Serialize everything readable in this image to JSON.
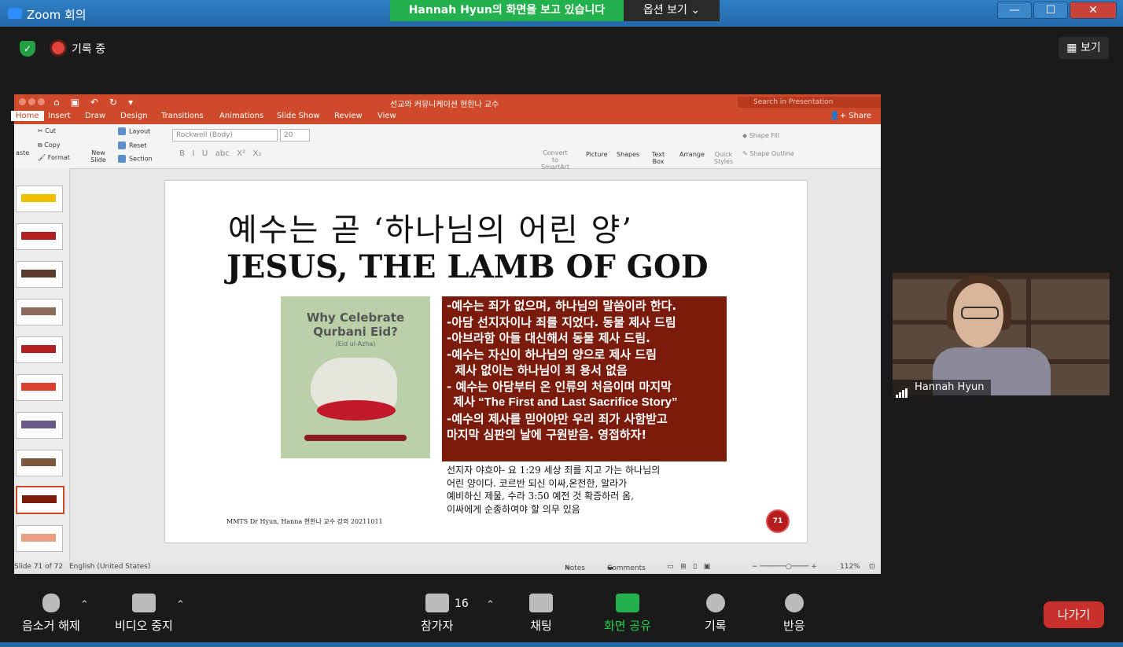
{
  "window": {
    "title": "Zoom 회의",
    "minimize": "—",
    "maximize": "☐",
    "close": "✕"
  },
  "share_banner": {
    "text": "Hannah Hyun의 화면을 보고 있습니다",
    "options": "옵션 보기 ⌄"
  },
  "meeting": {
    "recording": "기록 중",
    "view": "보기"
  },
  "ppt": {
    "doc_title": "선교와 커뮤니케이션 현한나 교수",
    "search_placeholder": "Search in Presentation",
    "share": "Share",
    "tabs": [
      "Home",
      "Insert",
      "Draw",
      "Design",
      "Transitions",
      "Animations",
      "Slide Show",
      "Review",
      "View"
    ],
    "ribbon": {
      "paste": "aste",
      "cut": "Cut",
      "copy": "Copy",
      "format": "Format",
      "new_slide": "New Slide",
      "layout": "Layout",
      "reset": "Reset",
      "section": "Section",
      "font": "Rockwell (Body)",
      "size": "20",
      "convert": "Convert to SmartArt",
      "picture": "Picture",
      "shapes": "Shapes",
      "text_box": "Text Box",
      "arrange": "Arrange",
      "quick_styles": "Quick Styles",
      "shape_fill": "Shape Fill",
      "shape_outline": "Shape Outline"
    },
    "status": {
      "slide": "Slide 71 of 72",
      "language": "English (United States)",
      "notes": "Notes",
      "comments": "Comments",
      "zoom": "112%"
    }
  },
  "slide": {
    "title_kr": "예수는 곧 ‘하나님의 어린 양’",
    "title_en": "JESUS, THE LAMB OF GOD",
    "book_title": "Why Celebrate Qurbani Eid?",
    "book_sub": "(Eid ul-Azha)",
    "lines": [
      "-예수는 죄가 없으며, 하나님의 말씀이라 한다.",
      "-아담 선지자이나 죄를 지었다. 동물 제사 드림",
      "-아브라함 아들 대신해서 동물 제사 드림.",
      "-예수는 자신이 하나님의 양으로 제사 드림",
      "  제사 없이는 하나님이 죄 용서 없음",
      "- 예수는 아담부터 온 인류의 처음이며 마지막",
      "  제사 “The First and Last Sacrifice Story”",
      "-예수의 제사를 믿어야만 우리 죄가 사함받고",
      "마지막 심판의 날에 구원받음. 영접하자!"
    ],
    "caption": [
      "선지자 야흐야- 요 1:29 세상 죄를 지고 가는 하나님의",
      "어린 양이다. 코르반 되신 이싸,온전한, 알라가",
      "예비하신 제물, 수라 3:50 예전 것 확증하러 옴,",
      "이싸에게 순종하여야 할 의무 있음"
    ],
    "footer": "MMTS Dr Hyun, Hanna 현한나 교수 강의 20211011",
    "page_badge": "71"
  },
  "video": {
    "name": "Hannah Hyun"
  },
  "toolbar": {
    "unmute": "음소거 해제",
    "stop_video": "비디오 중지",
    "participants": "참가자",
    "participants_count": "16",
    "chat": "채팅",
    "share_screen": "화면 공유",
    "record": "기록",
    "reactions": "반응",
    "leave": "나가기"
  }
}
